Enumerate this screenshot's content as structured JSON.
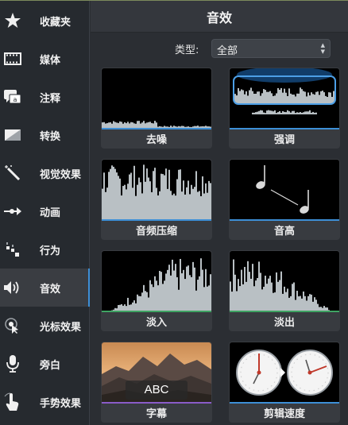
{
  "sidebar": {
    "items": [
      {
        "label": "收藏夹",
        "icon": "star-icon"
      },
      {
        "label": "媒体",
        "icon": "film-icon"
      },
      {
        "label": "注释",
        "icon": "annotation-icon"
      },
      {
        "label": "转换",
        "icon": "transition-icon"
      },
      {
        "label": "视觉效果",
        "icon": "magic-wand-icon"
      },
      {
        "label": "动画",
        "icon": "animation-arrow-icon"
      },
      {
        "label": "行为",
        "icon": "behavior-icon"
      },
      {
        "label": "音效",
        "icon": "speaker-icon",
        "active": true
      },
      {
        "label": "光标效果",
        "icon": "cursor-effect-icon"
      },
      {
        "label": "旁白",
        "icon": "microphone-icon"
      },
      {
        "label": "手势效果",
        "icon": "gesture-hand-icon"
      }
    ]
  },
  "header": {
    "title": "音效"
  },
  "filter": {
    "label": "类型:",
    "value": "全部"
  },
  "effects": [
    {
      "label": "去噪",
      "underline": "#3d8fd6"
    },
    {
      "label": "强调",
      "underline": "#3d8fd6"
    },
    {
      "label": "音频压缩",
      "underline": "#3d8fd6"
    },
    {
      "label": "音高",
      "underline": "#3d8fd6"
    },
    {
      "label": "淡入",
      "underline": "#3fa463"
    },
    {
      "label": "淡出",
      "underline": "#3fa463"
    },
    {
      "label": "字幕",
      "underline": "#8a5cc8",
      "caption_sample": "ABC"
    },
    {
      "label": "剪辑速度",
      "underline": "#3d8fd6"
    }
  ],
  "colors": {
    "accent": "#3d8fd6",
    "waveform": "#b9c0c4"
  }
}
